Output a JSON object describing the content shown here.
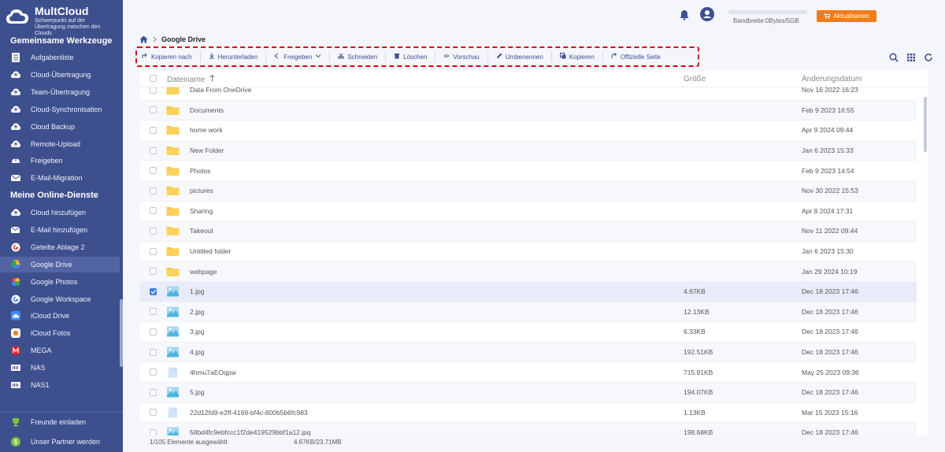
{
  "brand": {
    "name": "MultCloud",
    "tagline": "Schwerpunkt auf der Übertragung zwischen den Clouds"
  },
  "sidebar": {
    "tools_title": "Gemeinsame Werkzeuge",
    "tools": [
      {
        "label": "Aufgabenliste",
        "icon": "task-list-icon"
      },
      {
        "label": "Cloud-Übertragung",
        "icon": "cloud-transfer-icon"
      },
      {
        "label": "Team-Übertragung",
        "icon": "team-transfer-icon"
      },
      {
        "label": "Cloud-Synchronisation",
        "icon": "cloud-sync-icon"
      },
      {
        "label": "Cloud Backup",
        "icon": "cloud-backup-icon"
      },
      {
        "label": "Remote-Upload",
        "icon": "remote-upload-icon"
      },
      {
        "label": "Freigeben",
        "icon": "share-icon"
      },
      {
        "label": "E-Mail-Migration",
        "icon": "email-migration-icon"
      }
    ],
    "services_title": "Meine Online-Dienste",
    "services": [
      {
        "label": "Cloud hinzufügen",
        "icon": "add-cloud-icon"
      },
      {
        "label": "E-Mail hinzufügen",
        "icon": "add-email-icon"
      },
      {
        "label": "Geteilte Ablage 2",
        "icon": "google-icon"
      },
      {
        "label": "Google Drive",
        "icon": "google-drive-icon",
        "active": true
      },
      {
        "label": "Google Photos",
        "icon": "google-photos-icon"
      },
      {
        "label": "Google Workspace",
        "icon": "google-workspace-icon"
      },
      {
        "label": "iCloud Drive",
        "icon": "icloud-drive-icon"
      },
      {
        "label": "iCloud Fotos",
        "icon": "icloud-photos-icon"
      },
      {
        "label": "MEGA",
        "icon": "mega-icon"
      },
      {
        "label": "NAS",
        "icon": "nas-icon"
      },
      {
        "label": "NAS1",
        "icon": "nas-icon"
      }
    ],
    "bottom": [
      {
        "label": "Freunde einladen",
        "icon": "trophy-icon"
      },
      {
        "label": "Unser Partner werden",
        "icon": "dollar-icon"
      }
    ]
  },
  "header": {
    "bandwidth": "Bandbreite:0Bytes/5GB",
    "upgrade_label": "Aktualisieren"
  },
  "breadcrumb": {
    "current": "Google Drive"
  },
  "toolbar": [
    {
      "label": "Kopieren nach",
      "icon": "copy-to-icon"
    },
    {
      "label": "Herunterladen",
      "icon": "download-icon"
    },
    {
      "label": "Freigeben",
      "icon": "share-icon"
    },
    {
      "label": "Schneiden",
      "icon": "scissors-icon"
    },
    {
      "label": "Löschen",
      "icon": "trash-icon"
    },
    {
      "label": "Vorschau",
      "icon": "eye-icon"
    },
    {
      "label": "Umbenennen",
      "icon": "pencil-icon"
    },
    {
      "label": "Kopieren",
      "icon": "copy-icon"
    },
    {
      "label": "Offizielle Seite",
      "icon": "external-link-icon"
    }
  ],
  "table": {
    "col_name": "Dateiname",
    "col_size": "Größe",
    "col_date": "Änderungsdatum",
    "rows": [
      {
        "name": "Data From OneDrive",
        "size": "",
        "date": "Nov 16 2022 16:23",
        "type": "folder"
      },
      {
        "name": "Documents",
        "size": "",
        "date": "Feb 9 2023 16:55",
        "type": "folder"
      },
      {
        "name": "home work",
        "size": "",
        "date": "Apr 9 2024 09:44",
        "type": "folder"
      },
      {
        "name": "New Folder",
        "size": "",
        "date": "Jan 6 2023 15:33",
        "type": "folder"
      },
      {
        "name": "Photos",
        "size": "",
        "date": "Feb 9 2023 14:54",
        "type": "folder"
      },
      {
        "name": "pictures",
        "size": "",
        "date": "Nov 30 2022 15:53",
        "type": "folder"
      },
      {
        "name": "Sharing",
        "size": "",
        "date": "Apr 8 2024 17:31",
        "type": "folder"
      },
      {
        "name": "Takeout",
        "size": "",
        "date": "Nov 11 2022 09:44",
        "type": "folder"
      },
      {
        "name": "Untitled folder",
        "size": "",
        "date": "Jan 6 2023 15:30",
        "type": "folder"
      },
      {
        "name": "webpage",
        "size": "",
        "date": "Jan 29 2024 10:19",
        "type": "folder"
      },
      {
        "name": "1.jpg",
        "size": "4.67KB",
        "date": "Dec 18 2023 17:46",
        "type": "image",
        "selected": true
      },
      {
        "name": "2.jpg",
        "size": "12.13KB",
        "date": "Dec 18 2023 17:46",
        "type": "image"
      },
      {
        "name": "3.jpg",
        "size": "6.33KB",
        "date": "Dec 18 2023 17:46",
        "type": "image"
      },
      {
        "name": "4.jpg",
        "size": "192.51KB",
        "date": "Dec 18 2023 17:46",
        "type": "image"
      },
      {
        "name": "4hmu7aEOqpw",
        "size": "715.91KB",
        "date": "May 25 2023 09:36",
        "type": "file"
      },
      {
        "name": "5.jpg",
        "size": "194.07KB",
        "date": "Dec 18 2023 17:46",
        "type": "image"
      },
      {
        "name": "22d12fd9-e2ff-4169-bf4c-800b5b6fc983",
        "size": "1.13KB",
        "date": "Mar 15 2023 15:16",
        "type": "file"
      },
      {
        "name": "58bd4fc9ebfccc1f2de419529bbf1a12.jpg",
        "size": "198.68KB",
        "date": "Dec 18 2023 17:46",
        "type": "image"
      }
    ]
  },
  "status": {
    "selected": "1/105 Elemente ausgewählt",
    "size": "4.67KB/23.71MB"
  },
  "colors": {
    "sidebar": "#3e4f8e",
    "accent": "#f07d1a",
    "highlight": "#d9001b"
  }
}
